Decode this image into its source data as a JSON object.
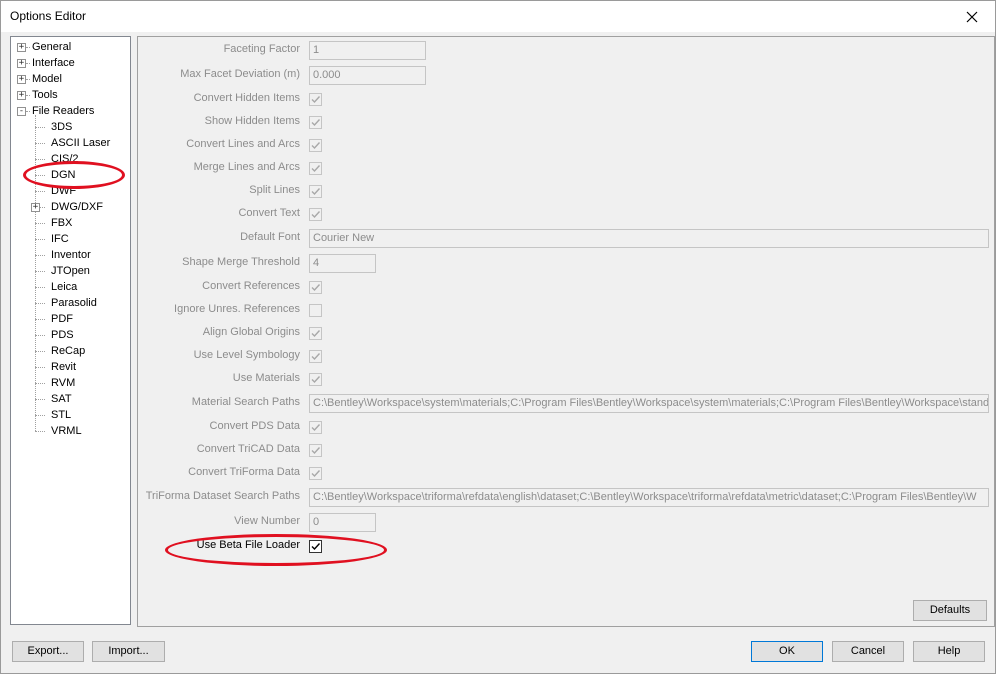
{
  "window": {
    "title": "Options Editor"
  },
  "tree": {
    "top": [
      {
        "label": "General",
        "expander": "+"
      },
      {
        "label": "Interface",
        "expander": "+"
      },
      {
        "label": "Model",
        "expander": "+"
      },
      {
        "label": "Tools",
        "expander": "+"
      },
      {
        "label": "File Readers",
        "expander": "-"
      }
    ],
    "readers": [
      {
        "label": "3DS"
      },
      {
        "label": "ASCII Laser"
      },
      {
        "label": "CIS/2"
      },
      {
        "label": "DGN",
        "selected": true
      },
      {
        "label": "DWF"
      },
      {
        "label": "DWG/DXF",
        "expander": "+"
      },
      {
        "label": "FBX"
      },
      {
        "label": "IFC"
      },
      {
        "label": "Inventor"
      },
      {
        "label": "JTOpen"
      },
      {
        "label": "Leica"
      },
      {
        "label": "Parasolid"
      },
      {
        "label": "PDF"
      },
      {
        "label": "PDS"
      },
      {
        "label": "ReCap"
      },
      {
        "label": "Revit"
      },
      {
        "label": "RVM"
      },
      {
        "label": "SAT"
      },
      {
        "label": "STL"
      },
      {
        "label": "VRML"
      }
    ]
  },
  "settings": [
    {
      "label": "Faceting Factor",
      "type": "text",
      "value": "1"
    },
    {
      "label": "Max Facet Deviation (m)",
      "type": "text",
      "value": "0.000"
    },
    {
      "label": "Convert Hidden Items",
      "type": "check",
      "checked": true
    },
    {
      "label": "Show Hidden Items",
      "type": "check",
      "checked": true
    },
    {
      "label": "Convert Lines and Arcs",
      "type": "check",
      "checked": true
    },
    {
      "label": "Merge Lines and Arcs",
      "type": "check",
      "checked": true
    },
    {
      "label": "Split Lines",
      "type": "check",
      "checked": true
    },
    {
      "label": "Convert Text",
      "type": "check",
      "checked": true
    },
    {
      "label": "Default Font",
      "type": "text",
      "value": "Courier New"
    },
    {
      "label": "Shape Merge Threshold",
      "type": "text",
      "value": "4"
    },
    {
      "label": "Convert References",
      "type": "check",
      "checked": true
    },
    {
      "label": "Ignore Unres. References",
      "type": "check",
      "checked": false
    },
    {
      "label": "Align Global Origins",
      "type": "check",
      "checked": true
    },
    {
      "label": "Use Level Symbology",
      "type": "check",
      "checked": true
    },
    {
      "label": "Use Materials",
      "type": "check",
      "checked": true
    },
    {
      "label": "Material Search Paths",
      "type": "text",
      "value": "C:\\Bentley\\Workspace\\system\\materials;C:\\Program Files\\Bentley\\Workspace\\system\\materials;C:\\Program Files\\Bentley\\Workspace\\standa"
    },
    {
      "label": "Convert PDS Data",
      "type": "check",
      "checked": true
    },
    {
      "label": "Convert TriCAD Data",
      "type": "check",
      "checked": true
    },
    {
      "label": "Convert TriForma Data",
      "type": "check",
      "checked": true
    },
    {
      "label": "TriForma Dataset Search Paths",
      "type": "text",
      "value": "C:\\Bentley\\Workspace\\triforma\\refdata\\english\\dataset;C:\\Bentley\\Workspace\\triforma\\refdata\\metric\\dataset;C:\\Program Files\\Bentley\\W"
    },
    {
      "label": "View Number",
      "type": "text",
      "value": "0"
    },
    {
      "label": "Use Beta File Loader",
      "type": "check",
      "checked": true,
      "active": true
    }
  ],
  "buttons": {
    "defaults": "Defaults",
    "export": "Export...",
    "import": "Import...",
    "ok": "OK",
    "cancel": "Cancel",
    "help": "Help"
  },
  "colors": {
    "highlight": "#e01020",
    "focus_border": "#0078d7"
  }
}
